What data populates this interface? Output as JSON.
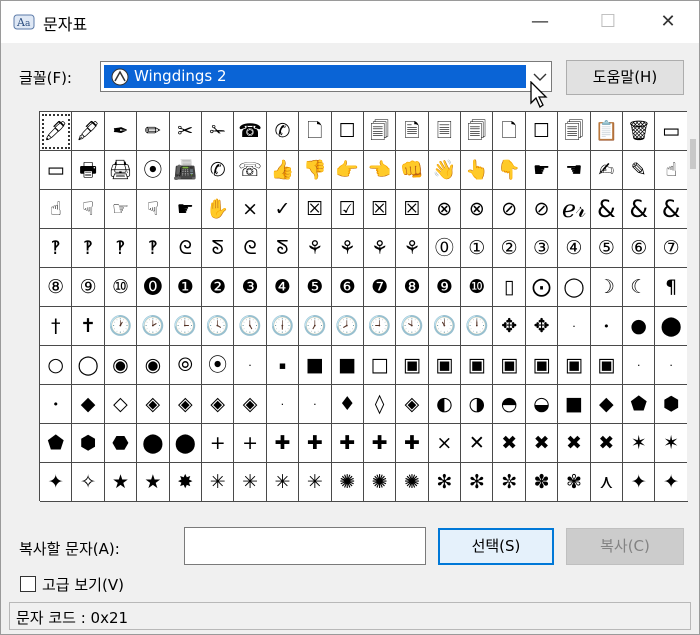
{
  "window": {
    "title": "문자표"
  },
  "titlebar": {
    "minimize": "—",
    "maximize": "☐",
    "close": "✕"
  },
  "font": {
    "label": "글꼴(F):",
    "selected": "Wingdings 2"
  },
  "help_button": "도움말(H)",
  "glyphs": [
    "🖊",
    "🖋",
    "✒",
    "✏",
    "✂",
    "✁",
    "☎",
    "✆",
    "🗋",
    "☐",
    "🗐",
    "🗎",
    "🗏",
    "🗐",
    "🗋",
    "☐",
    "🗐",
    "📋",
    "🗑",
    "▭",
    "▭",
    "🖶",
    "🖨",
    "⦿",
    "📠",
    "✆",
    "☏",
    "👍",
    "👎",
    "👉",
    "👈",
    "👊",
    "👋",
    "👆",
    "👇",
    "☛",
    "☚",
    "✍",
    "✎",
    "☝",
    "☝",
    "☟",
    "☞",
    "☟",
    "☛",
    "✋",
    "×",
    "✓",
    "☒",
    "☑",
    "☒",
    "☒",
    "⊗",
    "⊗",
    "⊘",
    "⊘",
    "ℯ𝓇",
    "&",
    "&",
    "&",
    "‽",
    "‽",
    "‽",
    "‽",
    "ᘓ",
    "ᘕ",
    "ᘓ",
    "ᘕ",
    "⚘",
    "⚘",
    "⚘",
    "⚘",
    "⓪",
    "①",
    "②",
    "③",
    "④",
    "⑤",
    "⑥",
    "⑦",
    "⑧",
    "⑨",
    "⑩",
    "⓿",
    "❶",
    "❷",
    "❸",
    "❹",
    "❺",
    "❻",
    "❼",
    "❽",
    "❾",
    "❿",
    "▯",
    "⨀",
    "◯",
    "☽",
    "☾",
    "¶",
    "†",
    "✝",
    "🕐",
    "🕑",
    "🕒",
    "🕓",
    "🕔",
    "🕕",
    "🕖",
    "🕗",
    "🕘",
    "🕙",
    "🕚",
    "🕛",
    "✥",
    "✥",
    "·",
    "•",
    "●",
    "⬤",
    "○",
    "◯",
    "◉",
    "◉",
    "⦾",
    "⦿",
    "·",
    "▪",
    "■",
    "■",
    "□",
    "▣",
    "▣",
    "▣",
    "▣",
    "▣",
    "▣",
    "▣",
    "·",
    "·",
    "•",
    "◆",
    "◇",
    "◈",
    "◈",
    "◈",
    "◈",
    "·",
    "·",
    "♦",
    "◊",
    "◈",
    "◐",
    "◑",
    "◓",
    "◒",
    "■",
    "◆",
    "⬟",
    "⬢",
    "⬟",
    "⬢",
    "⬣",
    "⬤",
    "⬤",
    "+",
    "+",
    "✚",
    "✚",
    "✚",
    "✚",
    "✚",
    "×",
    "✕",
    "✖",
    "✖",
    "✖",
    "✖",
    "✶",
    "✶",
    "✦",
    "✧",
    "★",
    "★",
    "✸",
    "✳",
    "✳",
    "✳",
    "✳",
    "✺",
    "✺",
    "✺",
    "✻",
    "✻",
    "✼",
    "✽",
    "✾",
    "⋏",
    "✦",
    "✦"
  ],
  "copy": {
    "label": "복사할 문자(A):",
    "value": ""
  },
  "select_button": "선택(S)",
  "copy_button": "복사(C)",
  "advanced": {
    "label": "고급 보기(V)",
    "checked": false
  },
  "status": "문자 코드 : 0x21",
  "colors": {
    "selection": "#0a64d6",
    "focus_border": "#0078d7"
  }
}
